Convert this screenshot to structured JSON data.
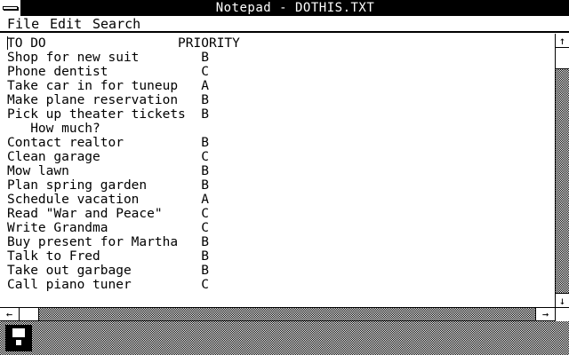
{
  "window": {
    "title": "Notepad - DOTHIS.TXT"
  },
  "menubar": {
    "items": [
      "File",
      "Edit",
      "Search"
    ]
  },
  "document": {
    "lines": [
      "TO DO                 PRIORITY",
      "Shop for new suit        B",
      "Phone dentist            C",
      "Take car in for tuneup   A",
      "Make plane reservation   B",
      "Pick up theater tickets  B",
      "   How much?",
      "Contact realtor          B",
      "Clean garage             C",
      "Mow lawn                 B",
      "Plan spring garden       B",
      "Schedule vacation        A",
      "Read \"War and Peace\"     C",
      "Write Grandma            C",
      "Buy present for Martha   B",
      "Talk to Fred             B",
      "Take out garbage         B",
      "Call piano tuner         C"
    ]
  },
  "scrollbars": {
    "up_glyph": "↑",
    "down_glyph": "↓",
    "left_glyph": "←",
    "right_glyph": "→"
  },
  "icons": {
    "taskbar": "floppy-disk-icon"
  },
  "colors": {
    "foreground": "#000000",
    "background": "#ffffff"
  }
}
